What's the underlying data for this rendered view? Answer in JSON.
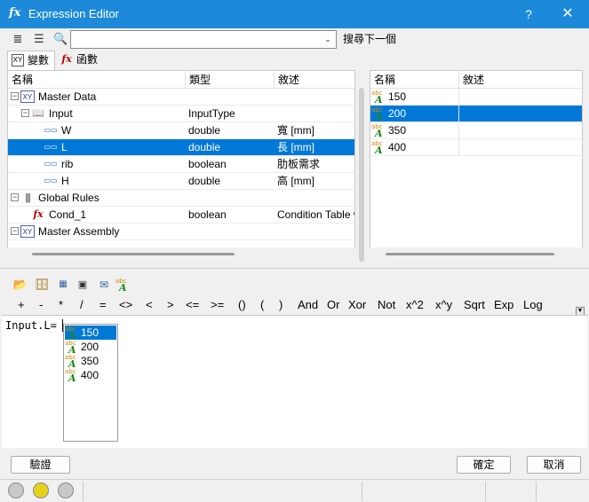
{
  "window": {
    "title": "Expression Editor",
    "app_icon": "fx",
    "help_label": "?",
    "close_label": "✕"
  },
  "search": {
    "value": "",
    "placeholder": "",
    "next_label": "搜尋下一個"
  },
  "tabs": [
    {
      "label": "變數",
      "icon": "variables-icon",
      "active": true
    },
    {
      "label": "函數",
      "icon": "function-icon",
      "active": false
    }
  ],
  "tree": {
    "columns": [
      "名稱",
      "類型",
      "敘述"
    ],
    "rows": [
      {
        "name": "Master Data",
        "type": "",
        "desc": "",
        "icon": "class-icon",
        "expander": "−",
        "level": 0
      },
      {
        "name": "Input",
        "type": "InputType",
        "desc": "",
        "icon": "book-icon",
        "expander": "−",
        "level": 1
      },
      {
        "name": "W",
        "type": "double",
        "desc": "寬 [mm]",
        "icon": "field-icon",
        "expander": "",
        "level": 2
      },
      {
        "name": "L",
        "type": "double",
        "desc": "長 [mm]",
        "icon": "field-icon",
        "expander": "",
        "level": 2,
        "selected": true
      },
      {
        "name": "rib",
        "type": "boolean",
        "desc": "肋板需求",
        "icon": "field-icon",
        "expander": "",
        "level": 2
      },
      {
        "name": "H",
        "type": "double",
        "desc": "高 [mm]",
        "icon": "field-icon",
        "expander": "",
        "level": 2
      },
      {
        "name": "Global Rules",
        "type": "",
        "desc": "",
        "icon": "rules-icon",
        "expander": "−",
        "level": 0
      },
      {
        "name": "Cond_1",
        "type": "boolean",
        "desc": "Condition Table w",
        "icon": "fx-icon",
        "expander": "",
        "level": 1
      },
      {
        "name": "Master Assembly",
        "type": "",
        "desc": "",
        "icon": "class-icon",
        "expander": "−",
        "level": 0
      }
    ]
  },
  "values": {
    "columns": [
      "名稱",
      "敘述"
    ],
    "rows": [
      {
        "name": "150",
        "desc": ""
      },
      {
        "name": "200",
        "desc": "",
        "selected": true
      },
      {
        "name": "350",
        "desc": ""
      },
      {
        "name": "400",
        "desc": ""
      }
    ]
  },
  "operators": [
    "+",
    "-",
    "*",
    "/",
    "=",
    "<>",
    "<",
    ">",
    "<=",
    ">=",
    "()",
    "(",
    ")",
    "And",
    "Or",
    "Xor",
    "Not",
    "x^2",
    "x^y",
    "Sqrt",
    "Exp",
    "Log"
  ],
  "editor": {
    "text": "Input.L=",
    "completions": [
      {
        "label": "150",
        "selected": true
      },
      {
        "label": "200"
      },
      {
        "label": "350"
      },
      {
        "label": "400"
      }
    ]
  },
  "buttons": {
    "validate": "驗證",
    "ok": "確定",
    "cancel": "取消"
  },
  "status": {
    "leds": [
      {
        "color": "#c8c8c8"
      },
      {
        "color": "#e6d21a"
      },
      {
        "color": "#c8c8c8"
      }
    ]
  },
  "abc_glyph": {
    "small": "abc",
    "big": "A"
  }
}
